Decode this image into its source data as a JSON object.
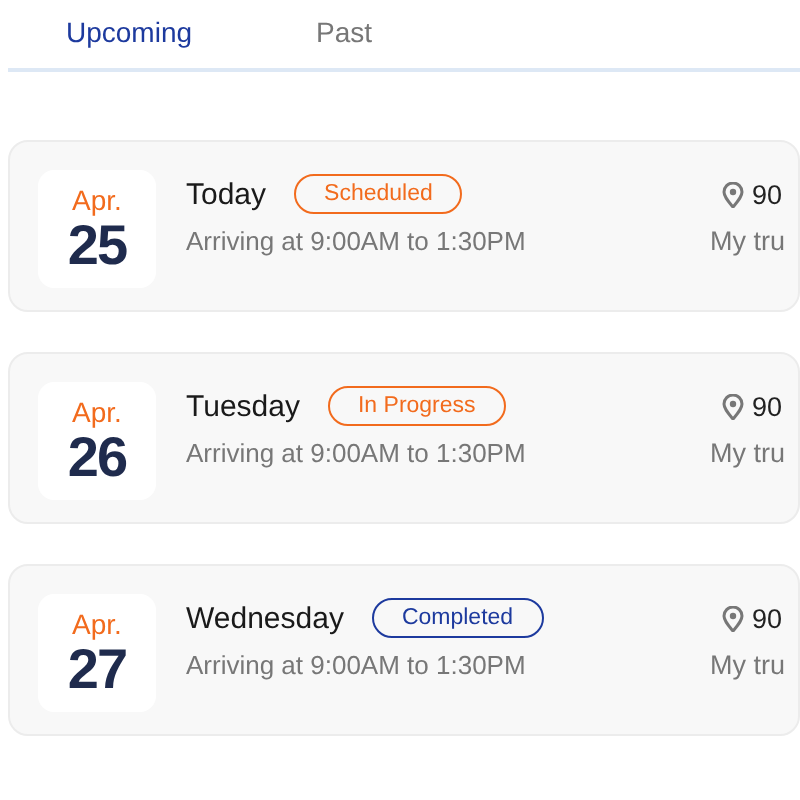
{
  "tabs": [
    {
      "label": "Upcoming",
      "selected": true
    },
    {
      "label": "Past",
      "selected": false
    }
  ],
  "deliveries": [
    {
      "month": "Apr.",
      "day": "25",
      "title": "Today",
      "status": "Scheduled",
      "color": "#f26b1d",
      "subtitle": "Arriving at 9:00AM to 1:30PM",
      "address": "90",
      "note": "My tru"
    },
    {
      "month": "Apr.",
      "day": "26",
      "title": "Tuesday",
      "status": "In Progress",
      "color": "#f26b1d",
      "subtitle": "Arriving at 9:00AM to 1:30PM",
      "address": "90",
      "note": "My tru"
    },
    {
      "month": "Apr.",
      "day": "27",
      "title": "Wednesday",
      "status": "Completed",
      "color": "#1d3a9e",
      "subtitle": "Arriving at 9:00AM to 1:30PM",
      "address": "90",
      "note": "My tru"
    }
  ]
}
